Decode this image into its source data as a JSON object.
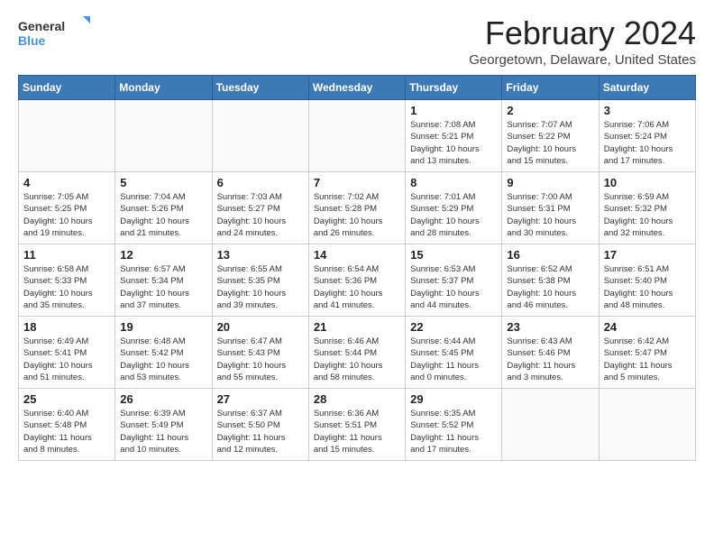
{
  "logo": {
    "text_general": "General",
    "text_blue": "Blue"
  },
  "title": "February 2024",
  "subtitle": "Georgetown, Delaware, United States",
  "days_of_week": [
    "Sunday",
    "Monday",
    "Tuesday",
    "Wednesday",
    "Thursday",
    "Friday",
    "Saturday"
  ],
  "weeks": [
    [
      {
        "num": "",
        "info": ""
      },
      {
        "num": "",
        "info": ""
      },
      {
        "num": "",
        "info": ""
      },
      {
        "num": "",
        "info": ""
      },
      {
        "num": "1",
        "info": "Sunrise: 7:08 AM\nSunset: 5:21 PM\nDaylight: 10 hours\nand 13 minutes."
      },
      {
        "num": "2",
        "info": "Sunrise: 7:07 AM\nSunset: 5:22 PM\nDaylight: 10 hours\nand 15 minutes."
      },
      {
        "num": "3",
        "info": "Sunrise: 7:06 AM\nSunset: 5:24 PM\nDaylight: 10 hours\nand 17 minutes."
      }
    ],
    [
      {
        "num": "4",
        "info": "Sunrise: 7:05 AM\nSunset: 5:25 PM\nDaylight: 10 hours\nand 19 minutes."
      },
      {
        "num": "5",
        "info": "Sunrise: 7:04 AM\nSunset: 5:26 PM\nDaylight: 10 hours\nand 21 minutes."
      },
      {
        "num": "6",
        "info": "Sunrise: 7:03 AM\nSunset: 5:27 PM\nDaylight: 10 hours\nand 24 minutes."
      },
      {
        "num": "7",
        "info": "Sunrise: 7:02 AM\nSunset: 5:28 PM\nDaylight: 10 hours\nand 26 minutes."
      },
      {
        "num": "8",
        "info": "Sunrise: 7:01 AM\nSunset: 5:29 PM\nDaylight: 10 hours\nand 28 minutes."
      },
      {
        "num": "9",
        "info": "Sunrise: 7:00 AM\nSunset: 5:31 PM\nDaylight: 10 hours\nand 30 minutes."
      },
      {
        "num": "10",
        "info": "Sunrise: 6:59 AM\nSunset: 5:32 PM\nDaylight: 10 hours\nand 32 minutes."
      }
    ],
    [
      {
        "num": "11",
        "info": "Sunrise: 6:58 AM\nSunset: 5:33 PM\nDaylight: 10 hours\nand 35 minutes."
      },
      {
        "num": "12",
        "info": "Sunrise: 6:57 AM\nSunset: 5:34 PM\nDaylight: 10 hours\nand 37 minutes."
      },
      {
        "num": "13",
        "info": "Sunrise: 6:55 AM\nSunset: 5:35 PM\nDaylight: 10 hours\nand 39 minutes."
      },
      {
        "num": "14",
        "info": "Sunrise: 6:54 AM\nSunset: 5:36 PM\nDaylight: 10 hours\nand 41 minutes."
      },
      {
        "num": "15",
        "info": "Sunrise: 6:53 AM\nSunset: 5:37 PM\nDaylight: 10 hours\nand 44 minutes."
      },
      {
        "num": "16",
        "info": "Sunrise: 6:52 AM\nSunset: 5:38 PM\nDaylight: 10 hours\nand 46 minutes."
      },
      {
        "num": "17",
        "info": "Sunrise: 6:51 AM\nSunset: 5:40 PM\nDaylight: 10 hours\nand 48 minutes."
      }
    ],
    [
      {
        "num": "18",
        "info": "Sunrise: 6:49 AM\nSunset: 5:41 PM\nDaylight: 10 hours\nand 51 minutes."
      },
      {
        "num": "19",
        "info": "Sunrise: 6:48 AM\nSunset: 5:42 PM\nDaylight: 10 hours\nand 53 minutes."
      },
      {
        "num": "20",
        "info": "Sunrise: 6:47 AM\nSunset: 5:43 PM\nDaylight: 10 hours\nand 55 minutes."
      },
      {
        "num": "21",
        "info": "Sunrise: 6:46 AM\nSunset: 5:44 PM\nDaylight: 10 hours\nand 58 minutes."
      },
      {
        "num": "22",
        "info": "Sunrise: 6:44 AM\nSunset: 5:45 PM\nDaylight: 11 hours\nand 0 minutes."
      },
      {
        "num": "23",
        "info": "Sunrise: 6:43 AM\nSunset: 5:46 PM\nDaylight: 11 hours\nand 3 minutes."
      },
      {
        "num": "24",
        "info": "Sunrise: 6:42 AM\nSunset: 5:47 PM\nDaylight: 11 hours\nand 5 minutes."
      }
    ],
    [
      {
        "num": "25",
        "info": "Sunrise: 6:40 AM\nSunset: 5:48 PM\nDaylight: 11 hours\nand 8 minutes."
      },
      {
        "num": "26",
        "info": "Sunrise: 6:39 AM\nSunset: 5:49 PM\nDaylight: 11 hours\nand 10 minutes."
      },
      {
        "num": "27",
        "info": "Sunrise: 6:37 AM\nSunset: 5:50 PM\nDaylight: 11 hours\nand 12 minutes."
      },
      {
        "num": "28",
        "info": "Sunrise: 6:36 AM\nSunset: 5:51 PM\nDaylight: 11 hours\nand 15 minutes."
      },
      {
        "num": "29",
        "info": "Sunrise: 6:35 AM\nSunset: 5:52 PM\nDaylight: 11 hours\nand 17 minutes."
      },
      {
        "num": "",
        "info": ""
      },
      {
        "num": "",
        "info": ""
      }
    ]
  ]
}
